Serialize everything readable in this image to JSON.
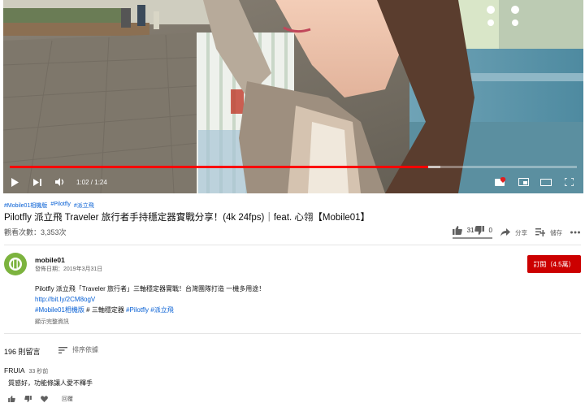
{
  "player": {
    "time_current": "1:02",
    "time_total": "1:24",
    "progress_fraction": 0.738,
    "progress_color": "#ff0000"
  },
  "video": {
    "tags": [
      "#Mobile01相機版",
      "#Pilotfly",
      "#派立飛"
    ],
    "title": "Pilotfly 派立飛 Traveler 旅行者手持穩定器實戰分享！(4k 24fps)｜feat. 心翎【Mobile01】",
    "views": "觀看次數：3,353次",
    "likes": "31",
    "dislikes": "0",
    "share_label": "分享",
    "save_label": "儲存"
  },
  "channel": {
    "name": "mobile01",
    "publish_date": "發佈日期：2019年3月31日",
    "subscribe_label": "訂閱（4.5萬）",
    "avatar_color": "#7cb33e"
  },
  "description": {
    "line1": "Pilotfly 派立飛「Traveler 旅行者」三軸穩定器實戰！台灣團隊打造 一機多用途！",
    "link": "http://bit.ly/2CM8ogV",
    "tag1": "#Mobile01相機版",
    "hash_sep": " # 三軸穩定器 ",
    "tag2": "#Pilotfly",
    "tag3": "#派立飛",
    "show_more": "顯示完整資訊"
  },
  "comments": {
    "count": "196 則留言",
    "sort_label": "排序依據",
    "first": {
      "author": "FRUIA",
      "time": "33 秒前",
      "text": "質感好，功能條讓人愛不釋手",
      "reply_label": "回覆"
    }
  }
}
